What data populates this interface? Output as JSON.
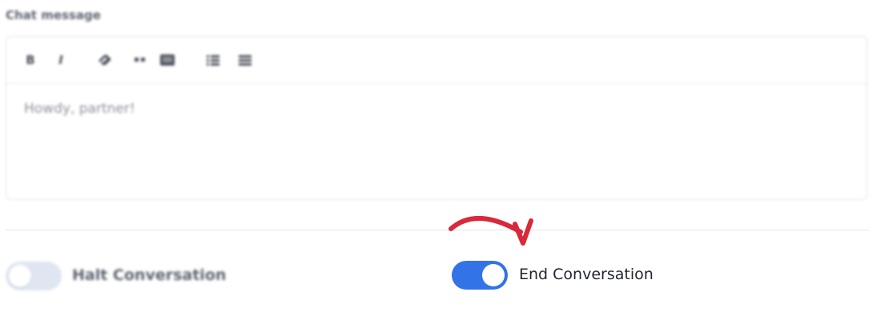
{
  "form": {
    "field_label": "Chat message",
    "editor_text": "Howdy, partner!",
    "toolbar": [
      {
        "name": "bold-icon",
        "glyph": "B"
      },
      {
        "name": "italic-icon",
        "glyph": "I"
      },
      {
        "name": "link-icon",
        "glyph": "🔗"
      },
      {
        "name": "quote-icon",
        "glyph": "”"
      },
      {
        "name": "image-icon",
        "glyph": "▣"
      },
      {
        "name": "ordered-list-icon",
        "glyph": "☰"
      },
      {
        "name": "bullet-list-icon",
        "glyph": "☰"
      }
    ]
  },
  "options": {
    "halt_label": "Halt Conversation",
    "halt_enabled": false,
    "end_label": "End Conversation",
    "end_enabled": true
  },
  "colors": {
    "toggle_on": "#3373e8",
    "toggle_off": "#dfe6f2",
    "annotation_arrow": "#d8283a"
  }
}
